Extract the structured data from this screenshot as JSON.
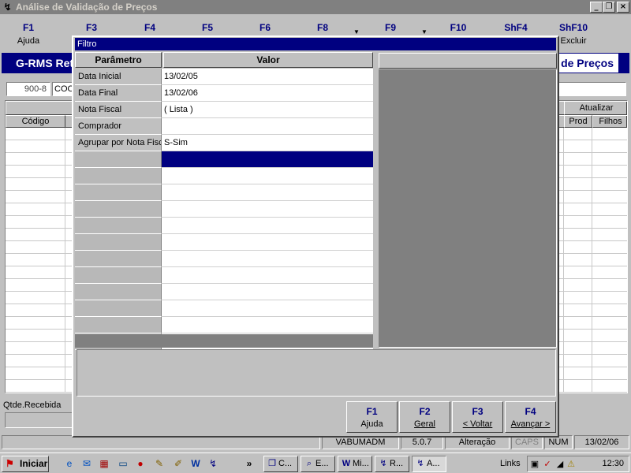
{
  "window": {
    "title": "Análise de Validação de Preços",
    "controls": [
      "_",
      "❐",
      "×"
    ]
  },
  "toolbar": {
    "keys": [
      {
        "key": "F1",
        "label": "Ajuda"
      },
      {
        "key": "F3",
        "label": ""
      },
      {
        "key": "F4",
        "label": ""
      },
      {
        "key": "F5",
        "label": ""
      },
      {
        "key": "F6",
        "label": ""
      },
      {
        "key": "F8",
        "label": ""
      },
      {
        "key": "F9",
        "label": ""
      },
      {
        "key": "F10",
        "label": ""
      },
      {
        "key": "ShF4",
        "label": ""
      },
      {
        "key": "ShF10",
        "label": "Excluir"
      }
    ]
  },
  "header": {
    "left_text": "G-RMS Reta",
    "right_text": "o de Preços"
  },
  "background_form": {
    "code_value": "900-8",
    "coo_value": "COO",
    "grid": {
      "col_codigo": "Código",
      "group_atualizar": "Atualizar",
      "col_prod": "Prod",
      "col_filhos": "Filhos"
    },
    "qtde_label": "Qtde.Recebida"
  },
  "dialog": {
    "title": "Filtro",
    "columns": {
      "param": "Parâmetro",
      "valor": "Valor"
    },
    "rows": [
      {
        "param": "Data Inicial",
        "value": "13/02/05"
      },
      {
        "param": "Data Final",
        "value": "13/02/06"
      },
      {
        "param": "Nota Fiscal",
        "value": "( Lista )"
      },
      {
        "param": "Comprador",
        "value": ""
      },
      {
        "param": "Agrupar por Nota Fisc",
        "value": "S-Sim"
      }
    ],
    "buttons": [
      {
        "key": "F1",
        "label": "Ajuda"
      },
      {
        "key": "F2",
        "label": "Geral"
      },
      {
        "key": "F3",
        "label": "< Voltar"
      },
      {
        "key": "F4",
        "label": "Avançar >"
      }
    ]
  },
  "statusbar": {
    "user": "VABUMADM",
    "version": "5.0.7",
    "mode": "Alteração",
    "caps": "CAPS",
    "num": "NUM",
    "date": "13/02/06"
  },
  "taskbar": {
    "start": "Iniciar",
    "overflow": "»",
    "tasks": [
      "C...",
      "E...",
      "Mi...",
      "R...",
      "A..."
    ],
    "links": "Links",
    "clock": "12:30"
  }
}
